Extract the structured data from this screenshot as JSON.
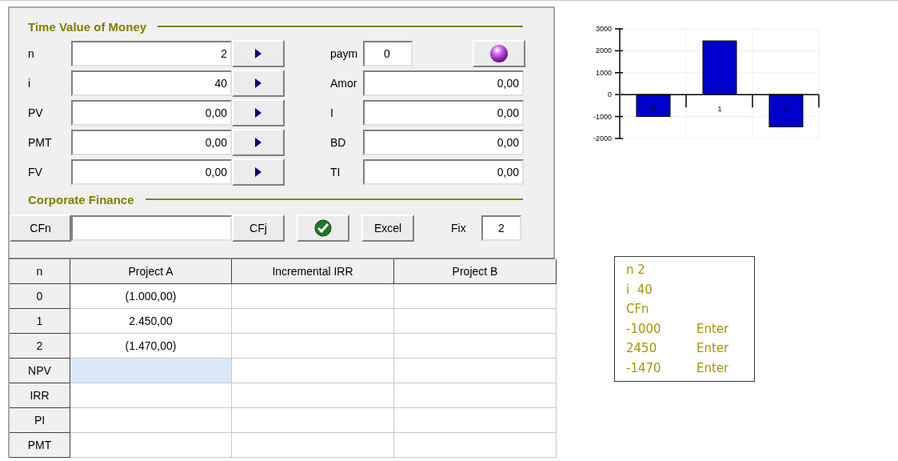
{
  "time_value_of_money": {
    "title": "Time Value of Money",
    "rows": [
      {
        "label": "n",
        "value": "2",
        "right": {
          "kind": "short",
          "label": "paym",
          "value": "0"
        }
      },
      {
        "label": "i",
        "value": "40",
        "right": {
          "kind": "wide",
          "label": "Amor",
          "value": "0,00"
        }
      },
      {
        "label": "PV",
        "value": "0,00",
        "right": {
          "kind": "wide",
          "label": "I",
          "value": "0,00"
        }
      },
      {
        "label": "PMT",
        "value": "0,00",
        "right": {
          "kind": "wide",
          "label": "BD",
          "value": "0,00"
        }
      },
      {
        "label": "FV",
        "value": "0,00",
        "right": {
          "kind": "wide",
          "label": "TI",
          "value": "0,00"
        }
      }
    ]
  },
  "corporate_finance": {
    "title": "Corporate Finance",
    "cfn_button": "CFn",
    "cfj_button": "CFj",
    "excel_button": "Excel",
    "fix_label": "Fix",
    "fix_value": "2"
  },
  "table": {
    "columns": [
      "n",
      "Project A",
      "Incremental IRR",
      "Project B"
    ],
    "rows": [
      {
        "label": "0",
        "cells": [
          {
            "text": "(1.000,00)",
            "selected": false
          },
          {
            "selected": false
          },
          {
            "selected": false
          }
        ]
      },
      {
        "label": "1",
        "cells": [
          {
            "text": "2.450,00",
            "selected": false
          },
          {
            "selected": false
          },
          {
            "selected": false
          }
        ]
      },
      {
        "label": "2",
        "cells": [
          {
            "text": "(1.470,00)",
            "selected": false
          },
          {
            "selected": false
          },
          {
            "selected": false
          }
        ]
      },
      {
        "label": "NPV",
        "cells": [
          {
            "selected": true
          },
          {
            "selected": false
          },
          {
            "selected": false
          }
        ]
      },
      {
        "label": "IRR",
        "cells": [
          {
            "selected": false
          },
          {
            "selected": false
          },
          {
            "selected": false
          }
        ]
      },
      {
        "label": "PI",
        "cells": [
          {
            "selected": false
          },
          {
            "selected": false
          },
          {
            "selected": false
          }
        ]
      },
      {
        "label": "PMT",
        "cells": [
          {
            "selected": false
          },
          {
            "selected": false
          },
          {
            "selected": false
          }
        ]
      }
    ]
  },
  "chart": {
    "chart_data": {
      "type": "bar",
      "categories": [
        "0",
        "1",
        "2"
      ],
      "series": [
        {
          "color": "#0000cc",
          "values": [
            -1000,
            2450,
            -1470
          ]
        }
      ],
      "grid": true,
      "ylim": [
        -2000,
        3000
      ],
      "yticks": [
        -2000,
        -1000,
        0,
        1000,
        2000,
        3000
      ]
    }
  },
  "keystrokes": [
    {
      "value": "n 2"
    },
    {
      "value": "i  40"
    },
    {
      "value": "CFn"
    },
    {
      "value": "-1000",
      "action": "Enter"
    },
    {
      "value": "2450",
      "action": "Enter"
    },
    {
      "value": "-1470",
      "action": "Enter"
    }
  ]
}
